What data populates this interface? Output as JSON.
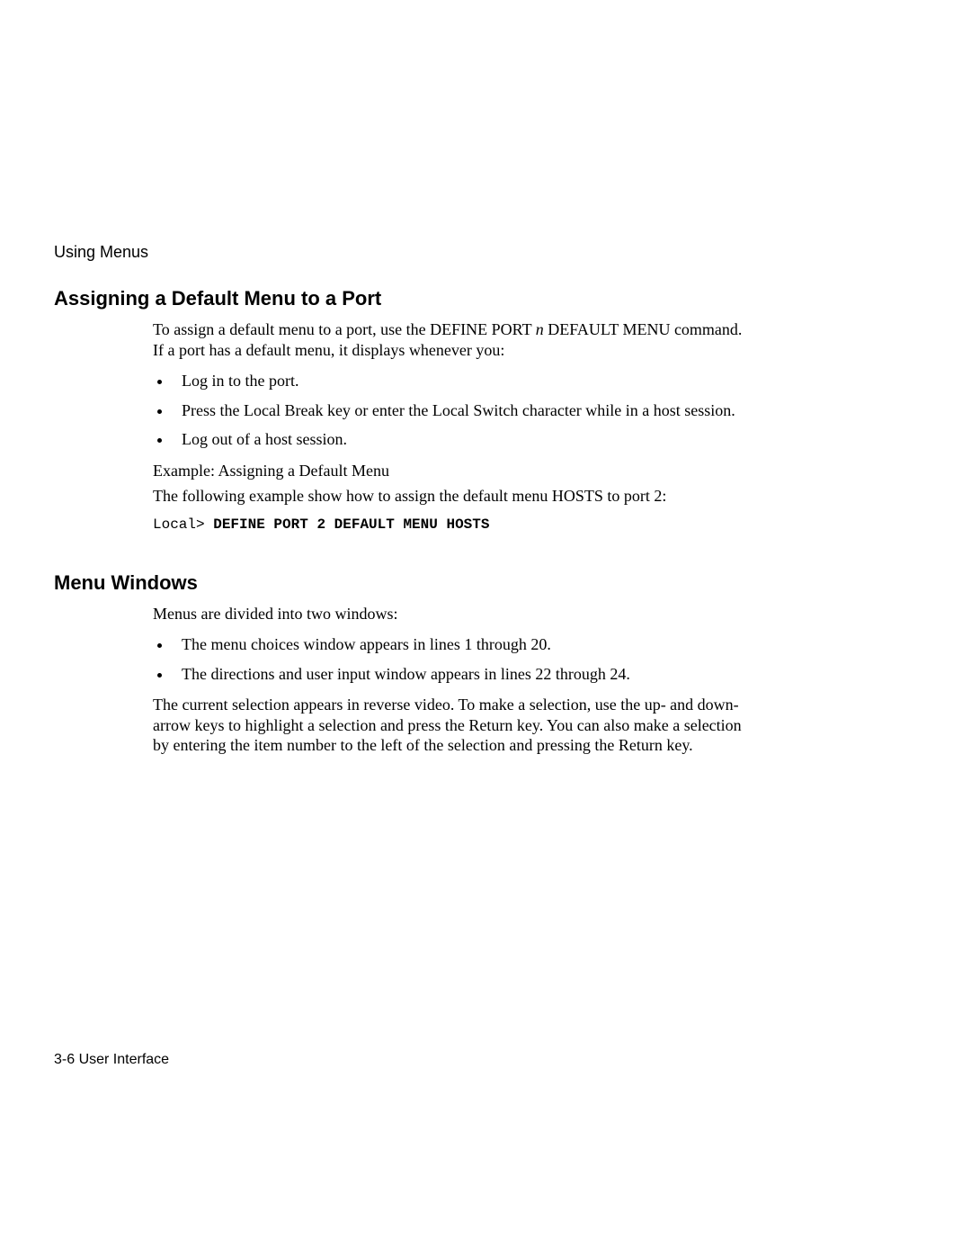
{
  "running_head": "Using Menus",
  "section1": {
    "heading": "Assigning a Default Menu to a Port",
    "intro_pre": "To assign a default menu to a port, use the DEFINE PORT ",
    "intro_italic": "n",
    "intro_post": " DEFAULT MENU command. If a port has a default menu, it displays whenever you:",
    "bullets": [
      "Log in to the port.",
      "Press the Local Break key or enter the Local Switch character while in a host session.",
      "Log out of a host session."
    ],
    "example_label": "Example: Assigning a Default Menu",
    "example_desc": "The following example show how to assign the default menu HOSTS to port 2:",
    "code_prompt": "Local> ",
    "code_cmd": "DEFINE PORT 2 DEFAULT MENU HOSTS"
  },
  "section2": {
    "heading": "Menu Windows",
    "intro": " Menus are divided into two windows:",
    "bullets": [
      "The menu choices window appears in lines 1 through 20.",
      "The directions and user input window appears in lines 22 through 24."
    ],
    "para": "The current selection appears in reverse video. To make a selection, use the up- and down-arrow keys to highlight a selection and press the Return key. You can also make a selection by entering the item number to the left of the selection and pressing the Return key."
  },
  "footer": "3-6  User Interface"
}
